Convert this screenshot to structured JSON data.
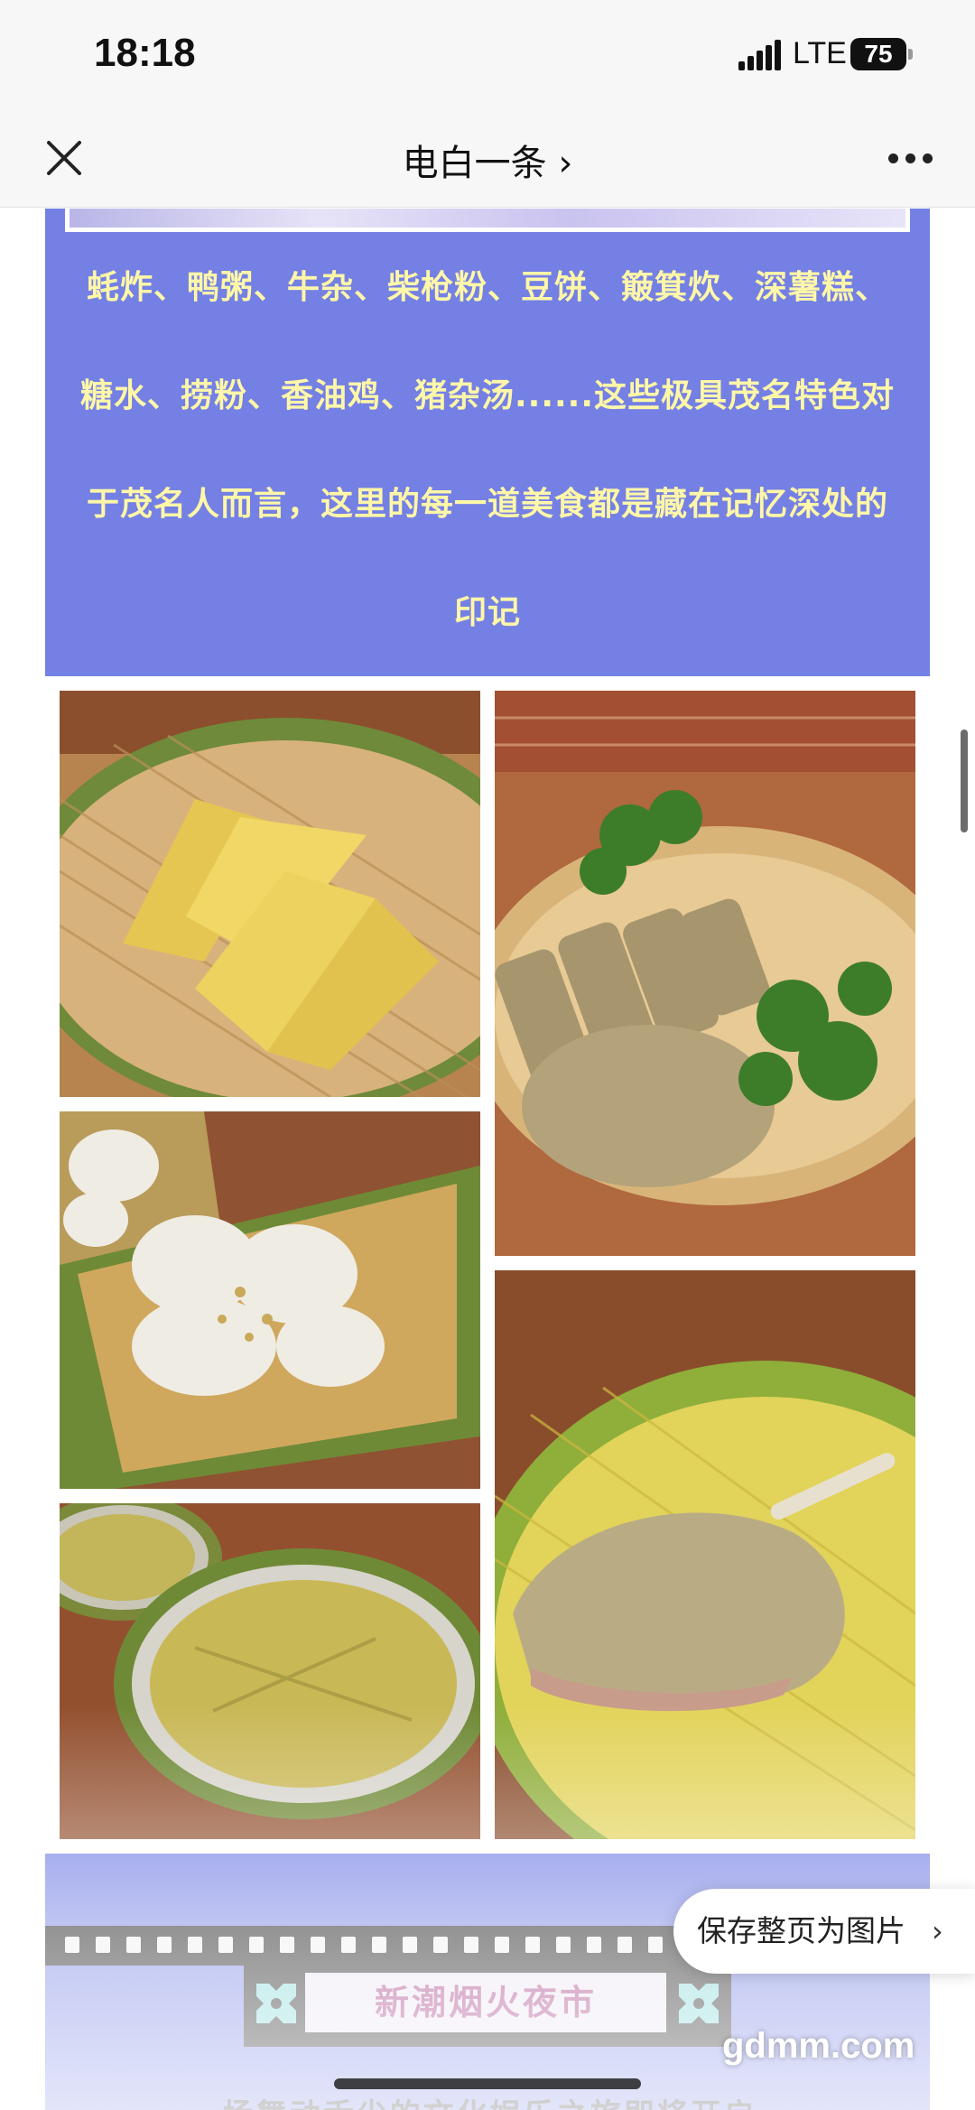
{
  "status_bar": {
    "time": "18:18",
    "network": "LTE",
    "battery": "75"
  },
  "nav": {
    "title": "电白一条 ›",
    "close_icon": "close-icon",
    "more_icon": "more-dots-icon"
  },
  "article": {
    "paragraph_lines": [
      "蚝炸、鸭粥、牛杂、柴枪粉、豆饼、簸箕炊、深薯糕、",
      "糖水、捞粉、香油鸡、猪杂汤......这些极具茂名特色对",
      "于茂名人而言，这里的每一道美食都是藏在记忆深处的",
      "印记"
    ],
    "photos": [
      "fried bean cakes on a bamboo basket",
      "sliced poached chicken with coriander",
      "rice noodle rolls with sesame",
      "roast goose leg on yellow bamboo tray",
      "steamed rice cakes on round trays"
    ],
    "banner_title": "新潮烟火夜市",
    "banner_subline": "一场舞动舌尖的文化娱乐之旅即将开启~"
  },
  "actions": {
    "save_page_label": "保存整页为图片",
    "save_page_chevron": "›"
  },
  "watermark": "gdmm.com",
  "colors": {
    "panel_bg": "#7480e4",
    "panel_text": "#fff7a8",
    "banner_text": "#a2317c"
  }
}
